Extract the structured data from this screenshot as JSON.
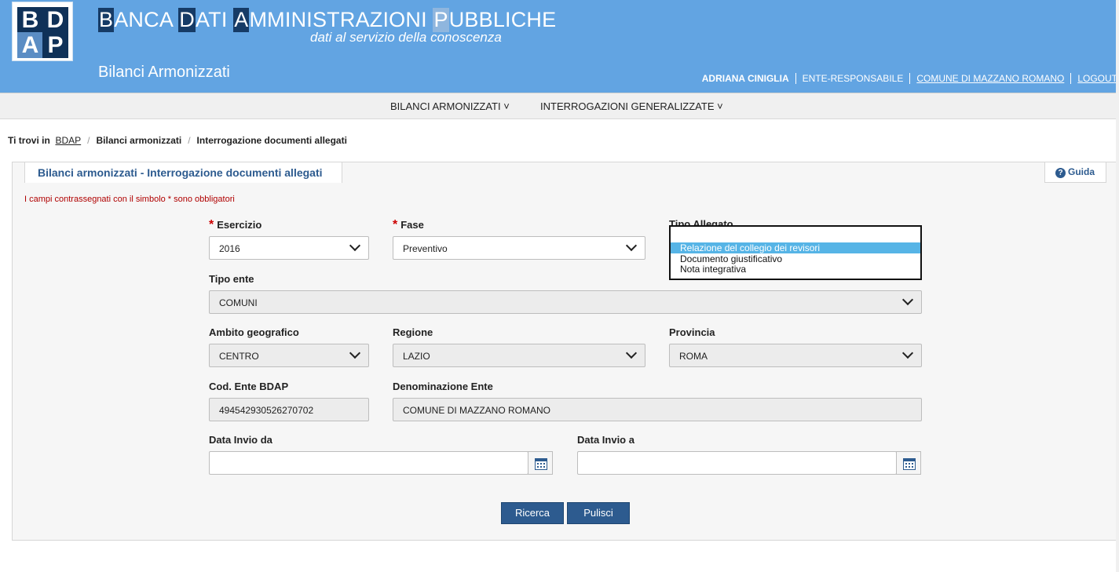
{
  "header": {
    "logo_letters": [
      "B",
      "D",
      "A",
      "P"
    ],
    "title_parts": [
      {
        "text": "B",
        "hl": true
      },
      {
        "text": "ANCA ",
        "hl": false
      },
      {
        "text": "D",
        "hl": true
      },
      {
        "text": "ATI ",
        "hl": false
      },
      {
        "text": "A",
        "hl": true
      },
      {
        "text": "MMINISTRAZIONI ",
        "hl": false
      },
      {
        "text": "P",
        "hl": "light"
      },
      {
        "text": "UBBLICHE",
        "hl": false
      }
    ],
    "tagline": "dati al servizio della conoscenza",
    "subtitle": "Bilanci Armonizzati",
    "user_name": "ADRIANA CINIGLIA",
    "user_role": "ENTE-RESPONSABILE",
    "entity": "COMUNE DI MAZZANO ROMANO",
    "logout": "LOGOUT"
  },
  "menu": {
    "items": [
      "BILANCI ARMONIZZATI ˅",
      "INTERROGAZIONI GENERALIZZATE ˅"
    ]
  },
  "breadcrumb": {
    "prefix": "Ti trovi in",
    "root": "BDAP",
    "level1": "Bilanci armonizzati",
    "level2": "Interrogazione documenti allegati"
  },
  "panel": {
    "title": "Bilanci armonizzati - Interrogazione documenti allegati",
    "guide": "Guida",
    "mandatory_note": "I campi contrassegnati con il simbolo * sono obbligatori"
  },
  "form": {
    "esercizio": {
      "label": "Esercizio",
      "value": "2016",
      "required": "*"
    },
    "fase": {
      "label": "Fase",
      "value": "Preventivo",
      "required": "*"
    },
    "tipo_allegato": {
      "label": "Tipo Allegato",
      "value": "",
      "options": [
        "Relazione del collegio dei revisori",
        "Documento giustificativo",
        "Nota integrativa"
      ],
      "selected_index": 0
    },
    "tipo_ente": {
      "label": "Tipo ente",
      "value": "COMUNI"
    },
    "ambito": {
      "label": "Ambito geografico",
      "value": "CENTRO"
    },
    "regione": {
      "label": "Regione",
      "value": "LAZIO"
    },
    "provincia": {
      "label": "Provincia",
      "value": "ROMA"
    },
    "cod_ente": {
      "label": "Cod. Ente BDAP",
      "value": "494542930526270702"
    },
    "denominazione": {
      "label": "Denominazione Ente",
      "value": "COMUNE DI MAZZANO ROMANO"
    },
    "data_da": {
      "label": "Data Invio da",
      "value": ""
    },
    "data_a": {
      "label": "Data Invio a",
      "value": ""
    }
  },
  "buttons": {
    "search": "Ricerca",
    "clear": "Pulisci"
  },
  "colors": {
    "header_bg": "#62a4e2",
    "accent": "#2d5b8f",
    "required": "#c00000",
    "dropdown_selected": "#56b4e6"
  }
}
